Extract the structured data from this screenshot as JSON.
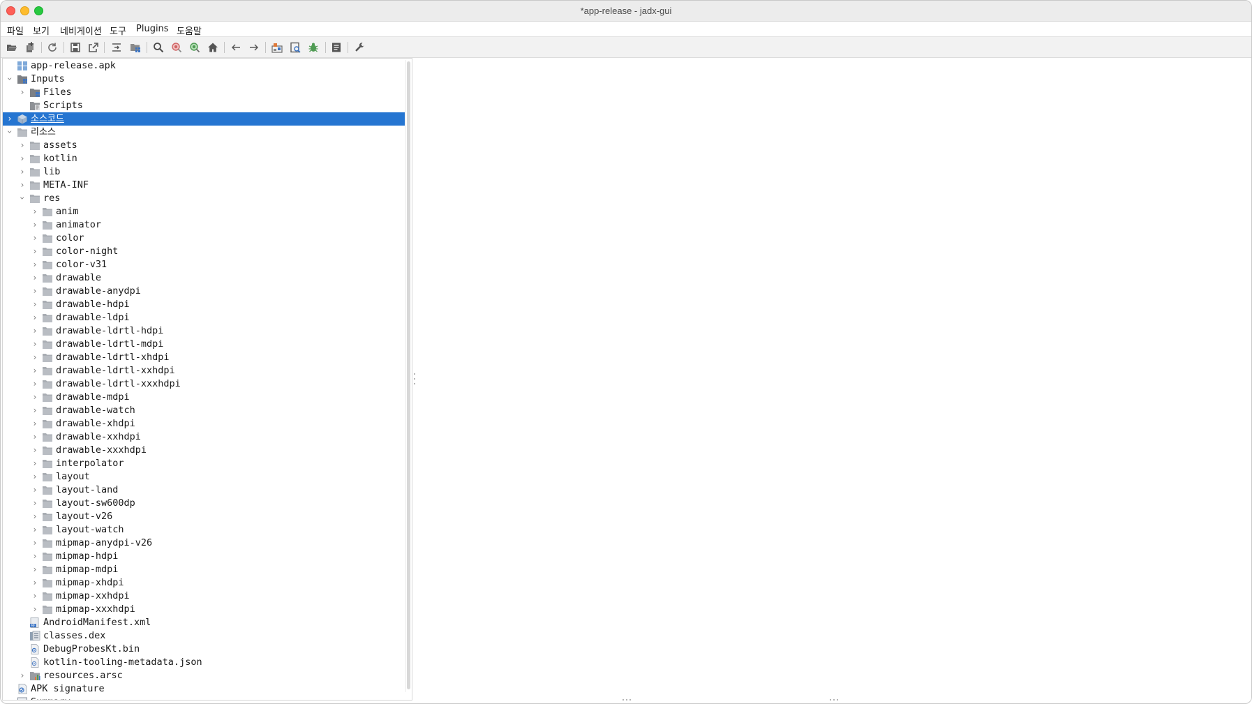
{
  "window": {
    "title": "*app-release - jadx-gui"
  },
  "menubar": {
    "items": [
      {
        "label": "파일"
      },
      {
        "label": "보기"
      },
      {
        "label": "네비게이션"
      },
      {
        "label": "도구"
      },
      {
        "label": "Plugins"
      },
      {
        "label": "도움말"
      }
    ]
  },
  "toolbar": {
    "buttons": [
      {
        "icon": "open-folder-icon"
      },
      {
        "icon": "add-files-icon"
      },
      {
        "icon": "reload-icon"
      },
      {
        "icon": "save-icon"
      },
      {
        "icon": "export-icon"
      },
      {
        "icon": "sync-editor-icon"
      },
      {
        "icon": "flatten-packages-icon"
      },
      {
        "icon": "search-icon"
      },
      {
        "icon": "find-class-icon"
      },
      {
        "icon": "find-usage-icon"
      },
      {
        "icon": "home-icon"
      },
      {
        "icon": "back-arrow-icon"
      },
      {
        "icon": "forward-arrow-icon"
      },
      {
        "icon": "deobfuscation-icon"
      },
      {
        "icon": "quick-tabs-icon"
      },
      {
        "icon": "debugger-icon"
      },
      {
        "icon": "log-viewer-icon"
      },
      {
        "icon": "preferences-wrench-icon"
      }
    ]
  },
  "tree": {
    "nodes": [
      {
        "label": "app-release.apk",
        "level": 0,
        "expander": "none",
        "icon": "apk-grid-icon",
        "font": "mono"
      },
      {
        "label": "Inputs",
        "level": 0,
        "expander": "open",
        "icon": "inputs-folder-icon",
        "font": "mono"
      },
      {
        "label": "Files",
        "level": 1,
        "expander": "closed",
        "icon": "files-folder-icon",
        "font": "mono"
      },
      {
        "label": "Scripts",
        "level": 1,
        "expander": "none",
        "icon": "scripts-folder-icon",
        "font": "mono"
      },
      {
        "label": "소스코드",
        "level": 0,
        "expander": "closed",
        "icon": "source-package-icon",
        "font": "sans",
        "selected": true
      },
      {
        "label": "리소스",
        "level": 0,
        "expander": "open",
        "icon": "resources-folder-icon",
        "font": "sans"
      },
      {
        "label": "assets",
        "level": 1,
        "expander": "closed",
        "icon": "folder-icon",
        "font": "mono"
      },
      {
        "label": "kotlin",
        "level": 1,
        "expander": "closed",
        "icon": "folder-icon",
        "font": "mono"
      },
      {
        "label": "lib",
        "level": 1,
        "expander": "closed",
        "icon": "folder-icon",
        "font": "mono"
      },
      {
        "label": "META-INF",
        "level": 1,
        "expander": "closed",
        "icon": "folder-icon",
        "font": "mono"
      },
      {
        "label": "res",
        "level": 1,
        "expander": "open",
        "icon": "folder-icon",
        "font": "mono"
      },
      {
        "label": "anim",
        "level": 2,
        "expander": "closed",
        "icon": "folder-icon",
        "font": "mono"
      },
      {
        "label": "animator",
        "level": 2,
        "expander": "closed",
        "icon": "folder-icon",
        "font": "mono"
      },
      {
        "label": "color",
        "level": 2,
        "expander": "closed",
        "icon": "folder-icon",
        "font": "mono"
      },
      {
        "label": "color-night",
        "level": 2,
        "expander": "closed",
        "icon": "folder-icon",
        "font": "mono"
      },
      {
        "label": "color-v31",
        "level": 2,
        "expander": "closed",
        "icon": "folder-icon",
        "font": "mono"
      },
      {
        "label": "drawable",
        "level": 2,
        "expander": "closed",
        "icon": "folder-icon",
        "font": "mono"
      },
      {
        "label": "drawable-anydpi",
        "level": 2,
        "expander": "closed",
        "icon": "folder-icon",
        "font": "mono"
      },
      {
        "label": "drawable-hdpi",
        "level": 2,
        "expander": "closed",
        "icon": "folder-icon",
        "font": "mono"
      },
      {
        "label": "drawable-ldpi",
        "level": 2,
        "expander": "closed",
        "icon": "folder-icon",
        "font": "mono"
      },
      {
        "label": "drawable-ldrtl-hdpi",
        "level": 2,
        "expander": "closed",
        "icon": "folder-icon",
        "font": "mono"
      },
      {
        "label": "drawable-ldrtl-mdpi",
        "level": 2,
        "expander": "closed",
        "icon": "folder-icon",
        "font": "mono"
      },
      {
        "label": "drawable-ldrtl-xhdpi",
        "level": 2,
        "expander": "closed",
        "icon": "folder-icon",
        "font": "mono"
      },
      {
        "label": "drawable-ldrtl-xxhdpi",
        "level": 2,
        "expander": "closed",
        "icon": "folder-icon",
        "font": "mono"
      },
      {
        "label": "drawable-ldrtl-xxxhdpi",
        "level": 2,
        "expander": "closed",
        "icon": "folder-icon",
        "font": "mono"
      },
      {
        "label": "drawable-mdpi",
        "level": 2,
        "expander": "closed",
        "icon": "folder-icon",
        "font": "mono"
      },
      {
        "label": "drawable-watch",
        "level": 2,
        "expander": "closed",
        "icon": "folder-icon",
        "font": "mono"
      },
      {
        "label": "drawable-xhdpi",
        "level": 2,
        "expander": "closed",
        "icon": "folder-icon",
        "font": "mono"
      },
      {
        "label": "drawable-xxhdpi",
        "level": 2,
        "expander": "closed",
        "icon": "folder-icon",
        "font": "mono"
      },
      {
        "label": "drawable-xxxhdpi",
        "level": 2,
        "expander": "closed",
        "icon": "folder-icon",
        "font": "mono"
      },
      {
        "label": "interpolator",
        "level": 2,
        "expander": "closed",
        "icon": "folder-icon",
        "font": "mono"
      },
      {
        "label": "layout",
        "level": 2,
        "expander": "closed",
        "icon": "folder-icon",
        "font": "mono"
      },
      {
        "label": "layout-land",
        "level": 2,
        "expander": "closed",
        "icon": "folder-icon",
        "font": "mono"
      },
      {
        "label": "layout-sw600dp",
        "level": 2,
        "expander": "closed",
        "icon": "folder-icon",
        "font": "mono"
      },
      {
        "label": "layout-v26",
        "level": 2,
        "expander": "closed",
        "icon": "folder-icon",
        "font": "mono"
      },
      {
        "label": "layout-watch",
        "level": 2,
        "expander": "closed",
        "icon": "folder-icon",
        "font": "mono"
      },
      {
        "label": "mipmap-anydpi-v26",
        "level": 2,
        "expander": "closed",
        "icon": "folder-icon",
        "font": "mono"
      },
      {
        "label": "mipmap-hdpi",
        "level": 2,
        "expander": "closed",
        "icon": "folder-icon",
        "font": "mono"
      },
      {
        "label": "mipmap-mdpi",
        "level": 2,
        "expander": "closed",
        "icon": "folder-icon",
        "font": "mono"
      },
      {
        "label": "mipmap-xhdpi",
        "level": 2,
        "expander": "closed",
        "icon": "folder-icon",
        "font": "mono"
      },
      {
        "label": "mipmap-xxhdpi",
        "level": 2,
        "expander": "closed",
        "icon": "folder-icon",
        "font": "mono"
      },
      {
        "label": "mipmap-xxxhdpi",
        "level": 2,
        "expander": "closed",
        "icon": "folder-icon",
        "font": "mono"
      },
      {
        "label": "AndroidManifest.xml",
        "level": 1,
        "expander": "none",
        "icon": "manifest-file-icon",
        "font": "mono"
      },
      {
        "label": "classes.dex",
        "level": 1,
        "expander": "none",
        "icon": "dex-file-icon",
        "font": "mono"
      },
      {
        "label": "DebugProbesKt.bin",
        "level": 1,
        "expander": "none",
        "icon": "binary-file-icon",
        "font": "mono"
      },
      {
        "label": "kotlin-tooling-metadata.json",
        "level": 1,
        "expander": "none",
        "icon": "json-file-icon",
        "font": "mono"
      },
      {
        "label": "resources.arsc",
        "level": 1,
        "expander": "closed",
        "icon": "arsc-file-icon",
        "font": "mono"
      },
      {
        "label": "APK signature",
        "level": 0,
        "expander": "none",
        "icon": "signature-icon",
        "font": "mono"
      },
      {
        "label": "Summary",
        "level": 0,
        "expander": "none",
        "icon": "summary-icon",
        "font": "mono"
      }
    ]
  },
  "colors": {
    "selection": "#2575d1",
    "folder": "#a9adb3",
    "package_blue": "#3b74c4"
  }
}
